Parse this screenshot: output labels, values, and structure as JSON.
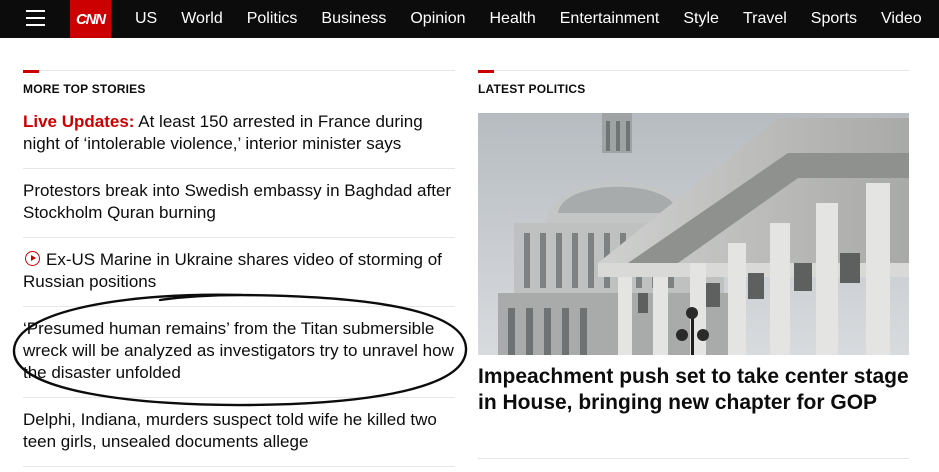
{
  "nav": {
    "logo": "CNN",
    "links": [
      "US",
      "World",
      "Politics",
      "Business",
      "Opinion",
      "Health",
      "Entertainment",
      "Style",
      "Travel",
      "Sports",
      "Video"
    ]
  },
  "left_section": {
    "title": "MORE TOP STORIES",
    "stories": [
      {
        "prefix": "Live Updates:",
        "text": " At least 150 arrested in France during night of ‘intolerable violence,’ interior minister says"
      },
      {
        "text": "Protestors break into Swedish embassy in Baghdad after Stockholm Quran burning"
      },
      {
        "text": "Ex-US Marine in Ukraine shares video of storming of Russian positions"
      },
      {
        "text": "‘Presumed human remains’ from the Titan submersible wreck will be analyzed as investigators try to unravel how the disaster unfolded"
      },
      {
        "text": "Delphi, Indiana, murders suspect told wife he killed two teen girls, unsealed documents allege"
      }
    ]
  },
  "right_section": {
    "title": "LATEST POLITICS",
    "headline": "Impeachment push set to take center stage in House, bringing new chapter for GOP"
  },
  "colors": {
    "brand_red": "#cc0000",
    "nav_bg": "#0c0c0c",
    "rule": "#e6e6e6"
  }
}
